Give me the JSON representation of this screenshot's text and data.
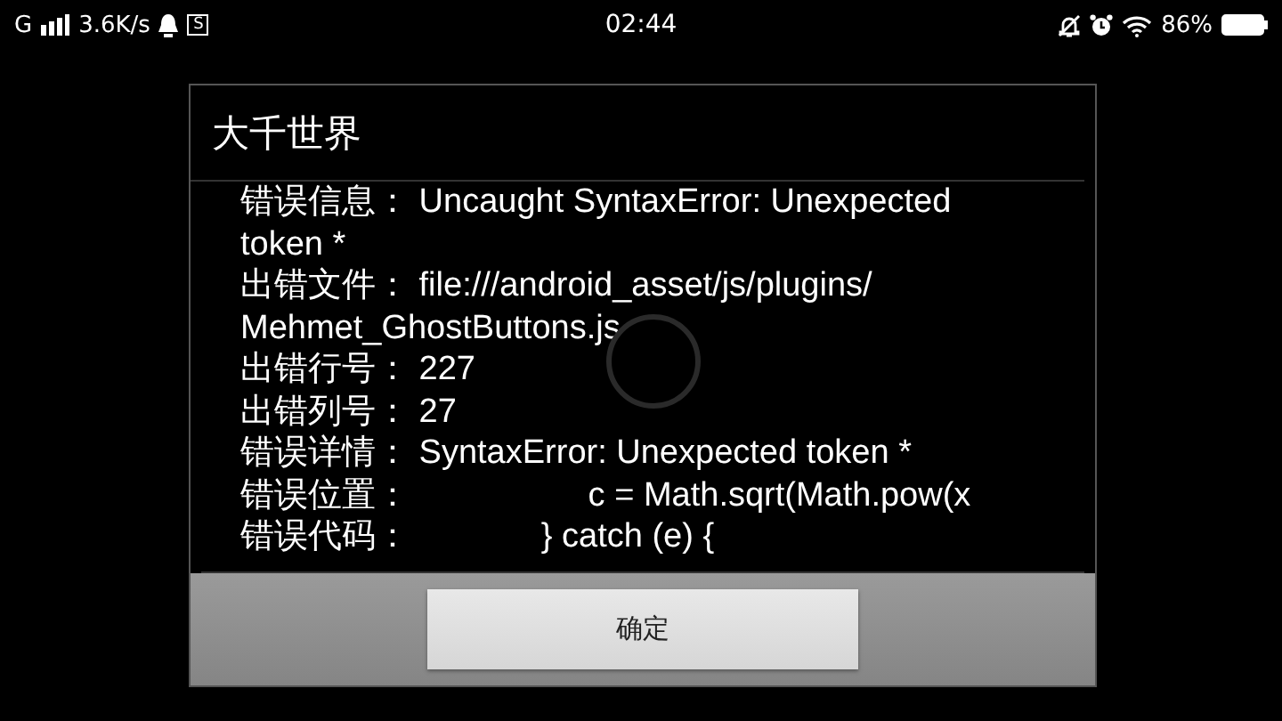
{
  "status_bar": {
    "network": "G",
    "speed": "3.6K/s",
    "app_badge": "S",
    "time": "02:44",
    "battery": "86%"
  },
  "dialog": {
    "title": "大千世界",
    "lines": [
      {
        "label": "错误信息：",
        "value": "Uncaught SyntaxError: Unexpected token *"
      },
      {
        "label": "出错文件：",
        "value": "file:///android_asset/js/plugins/ Mehmet_GhostButtons.js"
      },
      {
        "label": "出错行号：",
        "value": "227"
      },
      {
        "label": "出错列号：",
        "value": "27"
      },
      {
        "label": "错误详情：",
        "value": "SyntaxError: Unexpected token *"
      },
      {
        "label": "错误位置：",
        "value": "                  c = Math.sqrt(Math.pow(x"
      },
      {
        "label": "错误代码：",
        "value": "             } catch (e) {"
      }
    ],
    "button": "确定"
  }
}
